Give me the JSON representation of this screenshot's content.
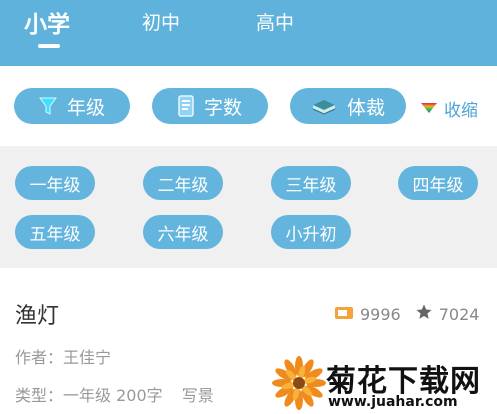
{
  "header": {
    "tabs": [
      {
        "label": "小学",
        "active": true
      },
      {
        "label": "初中",
        "active": false
      },
      {
        "label": "高中",
        "active": false
      }
    ]
  },
  "filters": {
    "items": [
      {
        "label": "年级",
        "icon": "funnel-icon"
      },
      {
        "label": "字数",
        "icon": "document-icon"
      },
      {
        "label": "体裁",
        "icon": "book-icon"
      }
    ],
    "collapse_label": "收缩",
    "collapse_icon": "triangle-down-icon"
  },
  "grades": [
    "一年级",
    "二年级",
    "三年级",
    "四年级",
    "五年级",
    "六年级",
    "小升初"
  ],
  "article": {
    "title": "渔灯",
    "views": "9996",
    "stars": "7024",
    "author": "作者：王佳宁",
    "type_line": "类型：一年级 200字",
    "genre": "写景"
  },
  "watermark": {
    "title": "菊花下载网",
    "url": "www.juahar.com"
  },
  "colors": {
    "header_bg": "#5fb2dc",
    "chip_bg": "#64b5de",
    "panel_bg": "#f0f0f0",
    "accent_link": "#4da3d6"
  }
}
